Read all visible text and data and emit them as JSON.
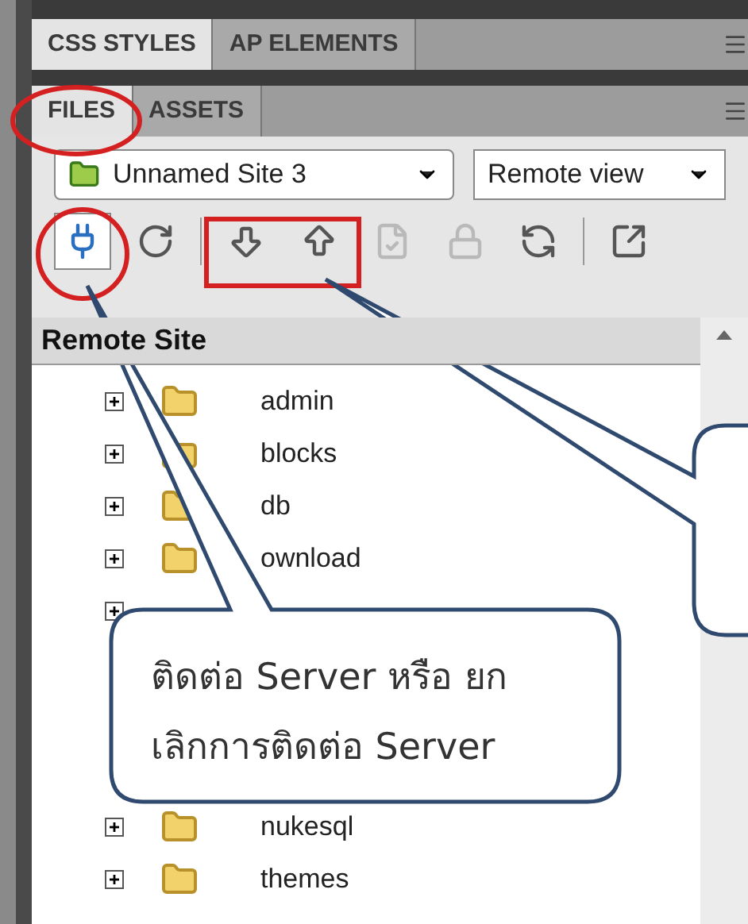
{
  "panel_groups": [
    {
      "tabs": [
        {
          "label": "CSS STYLES",
          "selected": true
        },
        {
          "label": "AP ELEMENTS",
          "selected": false
        }
      ]
    },
    {
      "tabs": [
        {
          "label": "FILES",
          "selected": true
        },
        {
          "label": "ASSETS",
          "selected": false
        }
      ]
    }
  ],
  "site_select": {
    "value": "Unnamed Site 3"
  },
  "view_select": {
    "value": "Remote view"
  },
  "toolbar": [
    {
      "kind": "connect",
      "selected": true,
      "disabled": false
    },
    {
      "kind": "refresh",
      "selected": false,
      "disabled": false
    },
    {
      "kind": "get",
      "selected": false,
      "disabled": false
    },
    {
      "kind": "put",
      "selected": false,
      "disabled": false
    },
    {
      "kind": "checkin",
      "selected": false,
      "disabled": true
    },
    {
      "kind": "checkout",
      "selected": false,
      "disabled": true
    },
    {
      "kind": "sync",
      "selected": false,
      "disabled": false
    },
    {
      "kind": "expand",
      "selected": false,
      "disabled": false
    }
  ],
  "file_list": {
    "header": "Remote Site",
    "items": [
      {
        "label": "admin",
        "expanded": false
      },
      {
        "label": "blocks",
        "expanded": false
      },
      {
        "label": "db",
        "expanded": false
      },
      {
        "label": "ownload",
        "expanded": false
      },
      {
        "expanded": false
      }
    ],
    "items_below_callout": [
      {
        "label": "nukesql",
        "expanded": false
      },
      {
        "label": "themes",
        "expanded": false
      }
    ]
  },
  "callout": {
    "lines": [
      "ติดต่อ Server หรือ ยก",
      "เลิกการติดต่อ Server"
    ]
  }
}
